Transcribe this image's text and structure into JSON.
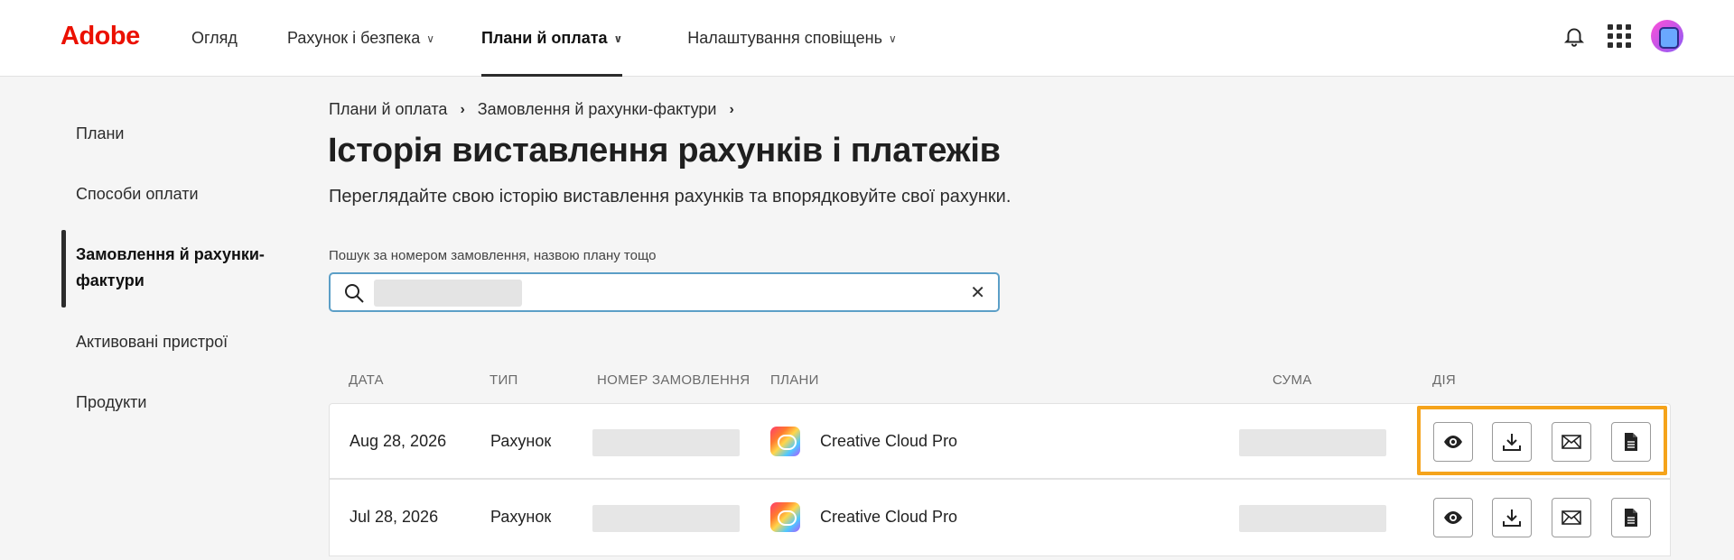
{
  "header": {
    "logo": "Adobe",
    "nav": [
      {
        "label": "Огляд"
      },
      {
        "label": "Рахунок і безпека"
      },
      {
        "label": "Плани й оплата"
      },
      {
        "label": "Налаштування сповіщень"
      }
    ],
    "icons": [
      "bell-icon",
      "apps-grid-icon",
      "avatar"
    ]
  },
  "sidebar": {
    "items": [
      {
        "label": "Плани"
      },
      {
        "label": "Способи оплати"
      },
      {
        "label": "Замовлення й рахунки-фактури",
        "label_line1": "Замовлення й рахунки-",
        "label_line2": "фактури",
        "active": true
      },
      {
        "label": "Активовані пристрої"
      },
      {
        "label": "Продукти"
      }
    ]
  },
  "breadcrumb": [
    "Плани й оплата",
    "Замовлення й рахунки-фактури"
  ],
  "page": {
    "title": "Історія виставлення рахунків і платежів",
    "subtitle": "Переглядайте свою історію виставлення рахунків та впорядковуйте свої рахунки."
  },
  "search": {
    "label": "Пошук за номером замовлення, назвою плану тощо",
    "value": ""
  },
  "table": {
    "headers": {
      "date": "ДАТА",
      "type": "ТИП",
      "order_number": "НОМЕР ЗАМОВЛЕННЯ",
      "plans": "ПЛАНИ",
      "amount": "СУМА",
      "action": "ДІЯ"
    },
    "rows": [
      {
        "date": "Aug 28, 2026",
        "type": "Рахунок",
        "order_number": "",
        "plan": "Creative Cloud Pro",
        "amount": ""
      },
      {
        "date": "Jul 28, 2026",
        "type": "Рахунок",
        "order_number": "",
        "plan": "Creative Cloud Pro",
        "amount": ""
      }
    ],
    "actions": [
      "view-icon",
      "download-icon",
      "email-icon",
      "document-icon"
    ]
  },
  "colors": {
    "brand": "#eb1000",
    "highlight": "#f5a31a",
    "search_border": "#5c9fc7"
  }
}
